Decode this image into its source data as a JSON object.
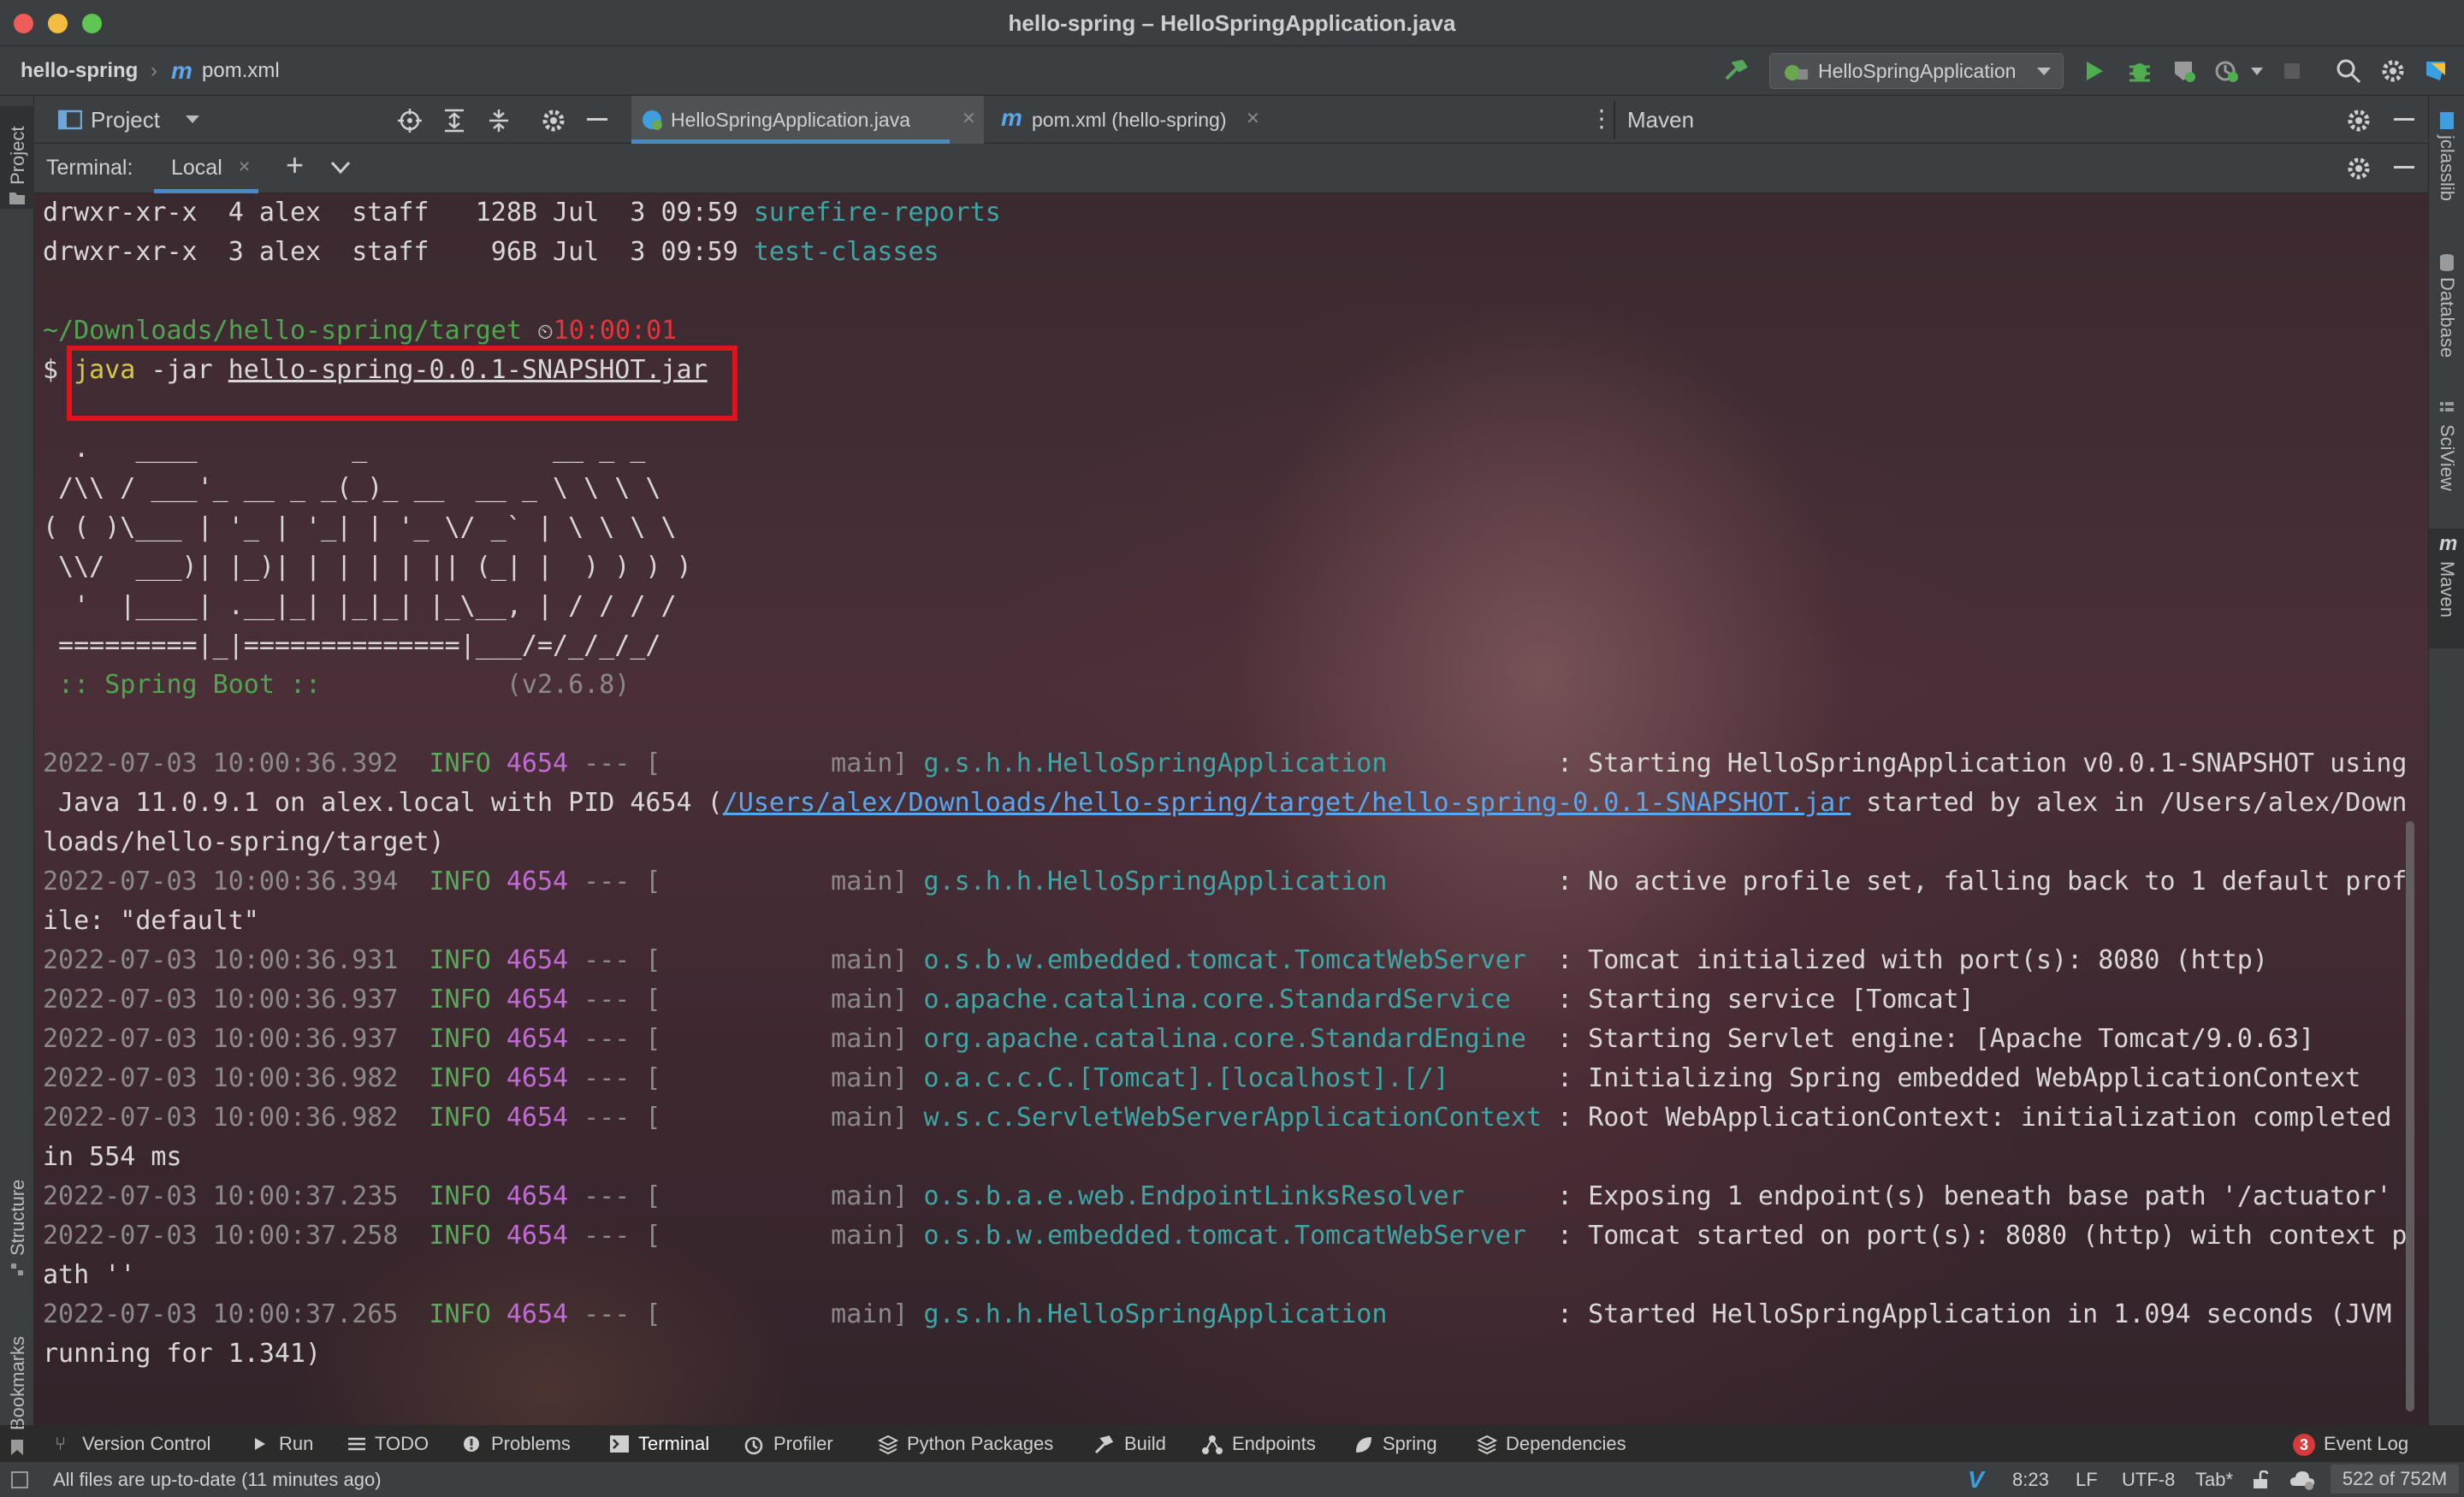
{
  "window": {
    "title": "hello-spring – HelloSpringApplication.java"
  },
  "navbar": {
    "project": "hello-spring",
    "file": "pom.xml",
    "run_config": "HelloSpringApplication"
  },
  "toolheader": {
    "project_label": "Project",
    "tabs": [
      {
        "label": "HelloSpringApplication.java",
        "active": true
      },
      {
        "label": "pom.xml (hello-spring)",
        "active": false
      }
    ],
    "maven_label": "Maven"
  },
  "terminal_header": {
    "title": "Terminal:",
    "tab": "Local"
  },
  "left_strip": {
    "top": "Project",
    "structure": "Structure",
    "bookmarks": "Bookmarks"
  },
  "right_strip": [
    "jclasslib",
    "Database",
    "SciView",
    "Maven"
  ],
  "terminal": {
    "ls_lines": [
      {
        "meta": "drwxr-xr-x  4 alex  staff   128B Jul  3 09:59 ",
        "name": "surefire-reports"
      },
      {
        "meta": "drwxr-xr-x  3 alex  staff    96B Jul  3 09:59 ",
        "name": "test-classes"
      }
    ],
    "prompt_path": "~/Downloads/hello-spring/target",
    "prompt_time": "10:00:01",
    "prompt_sign": "$ ",
    "cmd_java": "java",
    "cmd_flag": " -jar ",
    "cmd_jar": "hello-spring-0.0.1-SNAPSHOT.jar",
    "banner": [
      "  .   ____          _            __ _ _",
      " /\\\\ / ___'_ __ _ _(_)_ __  __ _ \\ \\ \\ \\",
      "( ( )\\___ | '_ | '_| | '_ \\/ _` | \\ \\ \\ \\",
      " \\\\/  ___)| |_)| | | | | || (_| |  ) ) ) )",
      "  '  |____| .__|_| |_|_| |_\\__, | / / / /",
      " =========|_|==============|___/=/_/_/_/"
    ],
    "spring_label": " :: Spring Boot :: ",
    "spring_version": "(v2.6.8)",
    "logs": [
      {
        "ts": "2022-07-03 10:00:36.392",
        "lvl": "INFO",
        "pid": "4654",
        "thread": " --- [           main] ",
        "logger": "g.s.h.h.HelloSpringApplication          ",
        "msg": " : Starting HelloSpringApplication v0.0.1-SNAPSHOT using"
      },
      {
        "ts": "2022-07-03 10:00:36.394",
        "lvl": "INFO",
        "pid": "4654",
        "thread": " --- [           main] ",
        "logger": "g.s.h.h.HelloSpringApplication          ",
        "msg": " : No active profile set, falling back to 1 default prof"
      },
      {
        "ts": "2022-07-03 10:00:36.931",
        "lvl": "INFO",
        "pid": "4654",
        "thread": " --- [           main] ",
        "logger": "o.s.b.w.embedded.tomcat.TomcatWebServer ",
        "msg": " : Tomcat initialized with port(s): 8080 (http)"
      },
      {
        "ts": "2022-07-03 10:00:36.937",
        "lvl": "INFO",
        "pid": "4654",
        "thread": " --- [           main] ",
        "logger": "o.apache.catalina.core.StandardService  ",
        "msg": " : Starting service [Tomcat]"
      },
      {
        "ts": "2022-07-03 10:00:36.937",
        "lvl": "INFO",
        "pid": "4654",
        "thread": " --- [           main] ",
        "logger": "org.apache.catalina.core.StandardEngine ",
        "msg": " : Starting Servlet engine: [Apache Tomcat/9.0.63]"
      },
      {
        "ts": "2022-07-03 10:00:36.982",
        "lvl": "INFO",
        "pid": "4654",
        "thread": " --- [           main] ",
        "logger": "o.a.c.c.C.[Tomcat].[localhost].[/]      ",
        "msg": " : Initializing Spring embedded WebApplicationContext"
      },
      {
        "ts": "2022-07-03 10:00:36.982",
        "lvl": "INFO",
        "pid": "4654",
        "thread": " --- [           main] ",
        "logger": "w.s.c.ServletWebServerApplicationContext",
        "msg": " : Root WebApplicationContext: initialization completed"
      },
      {
        "ts": "2022-07-03 10:00:37.235",
        "lvl": "INFO",
        "pid": "4654",
        "thread": " --- [           main] ",
        "logger": "o.s.b.a.e.web.EndpointLinksResolver     ",
        "msg": " : Exposing 1 endpoint(s) beneath base path '/actuator'"
      },
      {
        "ts": "2022-07-03 10:00:37.258",
        "lvl": "INFO",
        "pid": "4654",
        "thread": " --- [           main] ",
        "logger": "o.s.b.w.embedded.tomcat.TomcatWebServer ",
        "msg": " : Tomcat started on port(s): 8080 (http) with context p"
      },
      {
        "ts": "2022-07-03 10:00:37.265",
        "lvl": "INFO",
        "pid": "4654",
        "thread": " --- [           main] ",
        "logger": "g.s.h.h.HelloSpringApplication          ",
        "msg": " : Started HelloSpringApplication in 1.094 seconds (JVM"
      }
    ],
    "cont1_pre": " Java 11.0.9.1 on alex.local with PID 4654 (",
    "cont1_link": "/Users/alex/Downloads/hello-spring/target/hello-spring-0.0.1-SNAPSHOT.jar",
    "cont1_post": " started by alex in /Users/alex/Down",
    "cont1b": "loads/hello-spring/target)",
    "cont2": "ile: \"default\"",
    "cont3": "in 554 ms",
    "cont4": "ath ''",
    "cont5": "running for 1.341)"
  },
  "bottom_tools": [
    "Version Control",
    "Run",
    "TODO",
    "Problems",
    "Terminal",
    "Profiler",
    "Python Packages",
    "Build",
    "Endpoints",
    "Spring",
    "Dependencies"
  ],
  "event_log": {
    "count": "3",
    "label": "Event Log"
  },
  "status": {
    "message": "All files are up-to-date (11 minutes ago)",
    "position": "8:23",
    "line_sep": "LF",
    "encoding": "UTF-8",
    "indent": "Tab*",
    "memory": "522 of 752M"
  }
}
